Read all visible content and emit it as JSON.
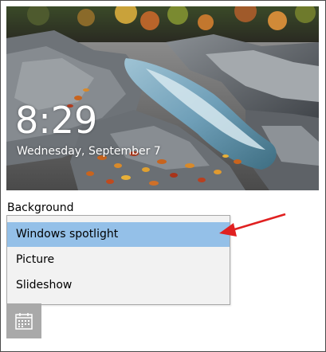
{
  "lock_screen": {
    "time": "8:29",
    "date": "Wednesday, September 7"
  },
  "background": {
    "label": "Background",
    "options": [
      "Windows spotlight",
      "Picture",
      "Slideshow"
    ],
    "selected": "Windows spotlight"
  },
  "icons": {
    "calendar": "calendar-icon",
    "annotation": "red-arrow"
  },
  "colors": {
    "selection": "#94c0e8",
    "arrow": "#e02020",
    "tile": "#a9a9a9"
  }
}
